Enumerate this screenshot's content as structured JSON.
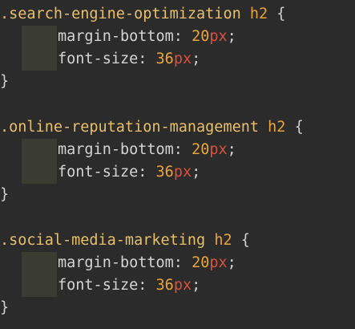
{
  "colors": {
    "background": "#2b2b2b",
    "selector": "#e8bf6a",
    "tag": "#e8a33d",
    "property": "#d4d4d4",
    "number": "#e8a33d",
    "unit": "#d9503f",
    "indent_guide": "#3a3b31"
  },
  "blocks": [
    {
      "selector": ".search-engine-optimization",
      "tag": "h2",
      "open": "{",
      "declarations": [
        {
          "property": "margin-bottom",
          "colon": ":",
          "number": "20",
          "unit": "px",
          "semi": ";"
        },
        {
          "property": "font-size",
          "colon": ":",
          "number": "36",
          "unit": "px",
          "semi": ";"
        }
      ],
      "close": "}"
    },
    {
      "selector": ".online-reputation-management",
      "tag": "h2",
      "open": "{",
      "declarations": [
        {
          "property": "margin-bottom",
          "colon": ":",
          "number": "20",
          "unit": "px",
          "semi": ";"
        },
        {
          "property": "font-size",
          "colon": ":",
          "number": "36",
          "unit": "px",
          "semi": ";"
        }
      ],
      "close": "}"
    },
    {
      "selector": ".social-media-marketing",
      "tag": "h2",
      "open": "{",
      "declarations": [
        {
          "property": "margin-bottom",
          "colon": ":",
          "number": "20",
          "unit": "px",
          "semi": ";"
        },
        {
          "property": "font-size",
          "colon": ":",
          "number": "36",
          "unit": "px",
          "semi": ";"
        }
      ],
      "close": "}"
    }
  ]
}
